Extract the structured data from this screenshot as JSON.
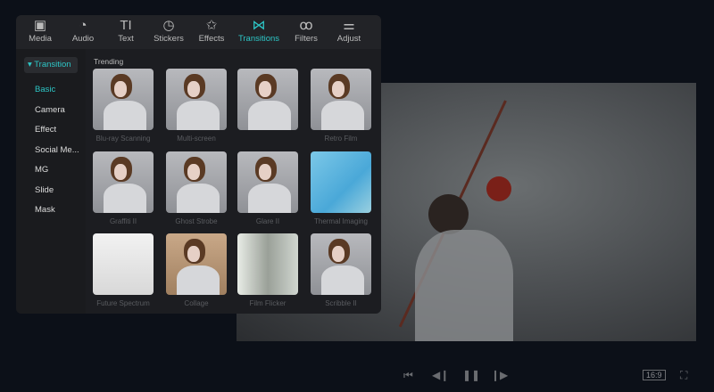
{
  "toolbar": [
    {
      "icon": "▣",
      "label": "Media"
    },
    {
      "icon": "◔",
      "label": "Audio"
    },
    {
      "icon": "TI",
      "label": "Text"
    },
    {
      "icon": "◷",
      "label": "Stickers"
    },
    {
      "icon": "✩",
      "label": "Effects"
    },
    {
      "icon": "⋈",
      "label": "Transitions",
      "active": true
    },
    {
      "icon": "ꝏ",
      "label": "Filters"
    },
    {
      "icon": "⚌",
      "label": "Adjust"
    }
  ],
  "sidebar": {
    "category": "▾ Transition",
    "items": [
      "Basic",
      "Camera",
      "Effect",
      "Social Me...",
      "MG",
      "Slide",
      "Mask"
    ]
  },
  "section_title": "Trending",
  "transitions": [
    "Blu-ray Scanning",
    "Multi-screen",
    "",
    "Retro Film",
    "Graffiti II",
    "Ghost Strobe",
    "Glare II",
    "Thermal Imaging",
    "Future Spectrum",
    "Collage",
    "Film Flicker",
    "Scribble II"
  ],
  "player": {
    "ratio": "16:9",
    "icons": [
      "⏮",
      "◀❙",
      "❚❚",
      "❙▶",
      "⛶"
    ]
  }
}
